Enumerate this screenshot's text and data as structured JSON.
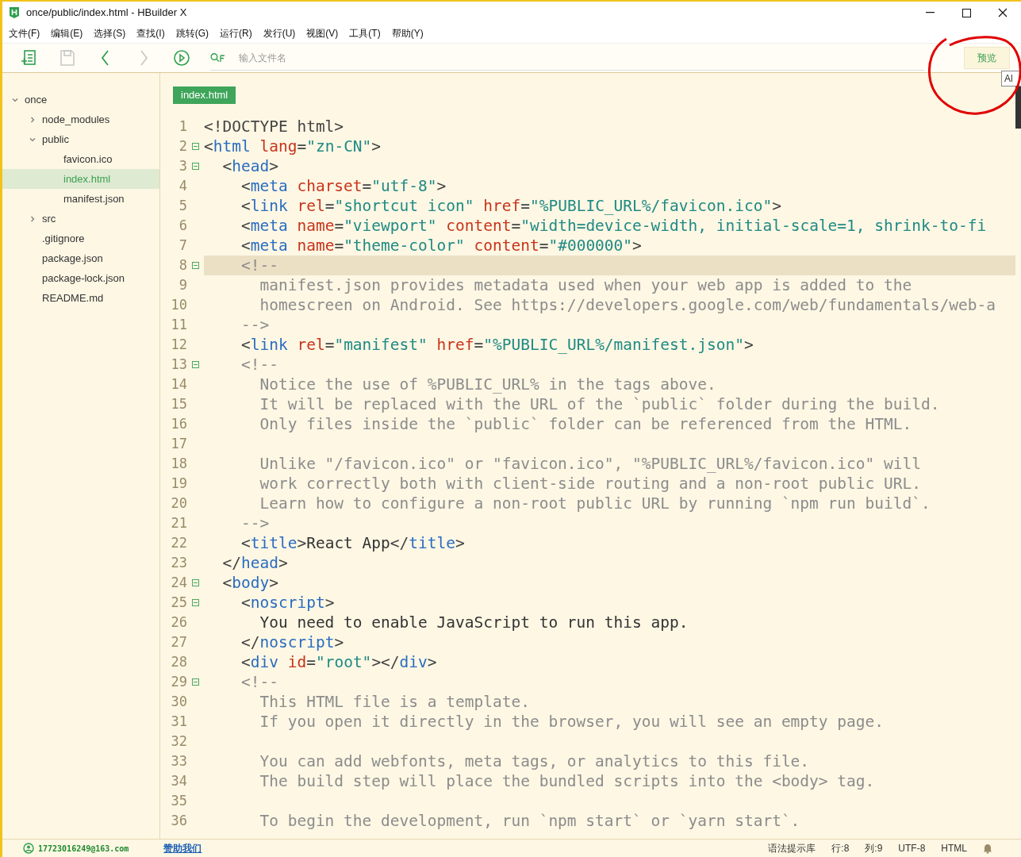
{
  "window": {
    "title": "once/public/index.html - HBuilder X"
  },
  "menu": [
    "文件(F)",
    "编辑(E)",
    "选择(S)",
    "查找(I)",
    "跳转(G)",
    "运行(R)",
    "发行(U)",
    "视图(V)",
    "工具(T)",
    "帮助(Y)"
  ],
  "toolbar": {
    "tools": [
      {
        "kind": "new",
        "disabled": false
      },
      {
        "kind": "save",
        "disabled": true
      },
      {
        "kind": "back",
        "disabled": false
      },
      {
        "kind": "forward",
        "disabled": true
      },
      {
        "kind": "run",
        "disabled": false
      }
    ],
    "search": {
      "placeholder": "输入文件名"
    },
    "preview_button": "预览",
    "tooltip": "Al"
  },
  "sidebar": {
    "items": [
      {
        "label": "once",
        "kind": "folder",
        "expanded": true,
        "selected": false,
        "children": [
          {
            "label": "node_modules",
            "kind": "folder",
            "expanded": false,
            "selected": false
          },
          {
            "label": "public",
            "kind": "folder",
            "expanded": true,
            "selected": false,
            "children": [
              {
                "label": "favicon.ico",
                "kind": "file",
                "selected": false
              },
              {
                "label": "index.html",
                "kind": "file",
                "selected": true
              },
              {
                "label": "manifest.json",
                "kind": "file",
                "selected": false
              }
            ]
          },
          {
            "label": "src",
            "kind": "folder",
            "expanded": false,
            "selected": false
          },
          {
            "label": ".gitignore",
            "kind": "file",
            "selected": false
          },
          {
            "label": "package.json",
            "kind": "file",
            "selected": false
          },
          {
            "label": "package-lock.json",
            "kind": "file",
            "selected": false
          },
          {
            "label": "README.md",
            "kind": "file",
            "selected": false
          }
        ]
      }
    ]
  },
  "tabs": [
    {
      "label": "index.html",
      "selected": true
    }
  ],
  "editor": {
    "lines": [
      {
        "number": "1",
        "foldable": false,
        "current": false,
        "tokens": [
          {
            "kind": "punct",
            "text": "<!DOCTYPE html>"
          }
        ]
      },
      {
        "number": "2",
        "foldable": true,
        "current": false,
        "tokens": [
          {
            "kind": "punct",
            "text": "<"
          },
          {
            "kind": "tag",
            "text": "html"
          },
          {
            "kind": "attr",
            "text": " lang"
          },
          {
            "kind": "punct",
            "text": "="
          },
          {
            "kind": "str",
            "text": "\"zn-CN\""
          },
          {
            "kind": "punct",
            "text": ">"
          }
        ]
      },
      {
        "number": "3",
        "foldable": true,
        "current": false,
        "tokens": [
          {
            "kind": "punct",
            "text": "  <"
          },
          {
            "kind": "tag",
            "text": "head"
          },
          {
            "kind": "punct",
            "text": ">"
          }
        ]
      },
      {
        "number": "4",
        "foldable": false,
        "current": false,
        "tokens": [
          {
            "kind": "punct",
            "text": "    <"
          },
          {
            "kind": "tag",
            "text": "meta"
          },
          {
            "kind": "attr",
            "text": " charset"
          },
          {
            "kind": "punct",
            "text": "="
          },
          {
            "kind": "str",
            "text": "\"utf-8\""
          },
          {
            "kind": "punct",
            "text": ">"
          }
        ]
      },
      {
        "number": "5",
        "foldable": false,
        "current": false,
        "tokens": [
          {
            "kind": "punct",
            "text": "    <"
          },
          {
            "kind": "tag",
            "text": "link"
          },
          {
            "kind": "attr",
            "text": " rel"
          },
          {
            "kind": "punct",
            "text": "="
          },
          {
            "kind": "str",
            "text": "\"shortcut icon\""
          },
          {
            "kind": "attr",
            "text": " href"
          },
          {
            "kind": "punct",
            "text": "="
          },
          {
            "kind": "str",
            "text": "\"%PUBLIC_URL%/favicon.ico\""
          },
          {
            "kind": "punct",
            "text": ">"
          }
        ]
      },
      {
        "number": "6",
        "foldable": false,
        "current": false,
        "tokens": [
          {
            "kind": "punct",
            "text": "    <"
          },
          {
            "kind": "tag",
            "text": "meta"
          },
          {
            "kind": "attr",
            "text": " name"
          },
          {
            "kind": "punct",
            "text": "="
          },
          {
            "kind": "str",
            "text": "\"viewport\""
          },
          {
            "kind": "attr",
            "text": " content"
          },
          {
            "kind": "punct",
            "text": "="
          },
          {
            "kind": "str",
            "text": "\"width=device-width, initial-scale=1, shrink-to-fi"
          }
        ]
      },
      {
        "number": "7",
        "foldable": false,
        "current": false,
        "tokens": [
          {
            "kind": "punct",
            "text": "    <"
          },
          {
            "kind": "tag",
            "text": "meta"
          },
          {
            "kind": "attr",
            "text": " name"
          },
          {
            "kind": "punct",
            "text": "="
          },
          {
            "kind": "str",
            "text": "\"theme-color\""
          },
          {
            "kind": "attr",
            "text": " content"
          },
          {
            "kind": "punct",
            "text": "="
          },
          {
            "kind": "str",
            "text": "\"#000000\""
          },
          {
            "kind": "punct",
            "text": ">"
          }
        ]
      },
      {
        "number": "8",
        "foldable": true,
        "current": true,
        "tokens": [
          {
            "kind": "comment",
            "text": "    <!--"
          }
        ]
      },
      {
        "number": "9",
        "foldable": false,
        "current": false,
        "tokens": [
          {
            "kind": "comment",
            "text": "      manifest.json provides metadata used when your web app is added to the"
          }
        ]
      },
      {
        "number": "10",
        "foldable": false,
        "current": false,
        "tokens": [
          {
            "kind": "comment",
            "text": "      homescreen on Android. See https://developers.google.com/web/fundamentals/web-a"
          }
        ]
      },
      {
        "number": "11",
        "foldable": false,
        "current": false,
        "tokens": [
          {
            "kind": "comment",
            "text": "    -->"
          }
        ]
      },
      {
        "number": "12",
        "foldable": false,
        "current": false,
        "tokens": [
          {
            "kind": "punct",
            "text": "    <"
          },
          {
            "kind": "tag",
            "text": "link"
          },
          {
            "kind": "attr",
            "text": " rel"
          },
          {
            "kind": "punct",
            "text": "="
          },
          {
            "kind": "str",
            "text": "\"manifest\""
          },
          {
            "kind": "attr",
            "text": " href"
          },
          {
            "kind": "punct",
            "text": "="
          },
          {
            "kind": "str",
            "text": "\"%PUBLIC_URL%/manifest.json\""
          },
          {
            "kind": "punct",
            "text": ">"
          }
        ]
      },
      {
        "number": "13",
        "foldable": true,
        "current": false,
        "tokens": [
          {
            "kind": "comment",
            "text": "    <!--"
          }
        ]
      },
      {
        "number": "14",
        "foldable": false,
        "current": false,
        "tokens": [
          {
            "kind": "comment",
            "text": "      Notice the use of %PUBLIC_URL% in the tags above."
          }
        ]
      },
      {
        "number": "15",
        "foldable": false,
        "current": false,
        "tokens": [
          {
            "kind": "comment",
            "text": "      It will be replaced with the URL of the `public` folder during the build."
          }
        ]
      },
      {
        "number": "16",
        "foldable": false,
        "current": false,
        "tokens": [
          {
            "kind": "comment",
            "text": "      Only files inside the `public` folder can be referenced from the HTML."
          }
        ]
      },
      {
        "number": "17",
        "foldable": false,
        "current": false
      },
      {
        "number": "18",
        "foldable": false,
        "current": false,
        "tokens": [
          {
            "kind": "comment",
            "text": "      Unlike \"/favicon.ico\" or \"favicon.ico\", \"%PUBLIC_URL%/favicon.ico\" will"
          }
        ]
      },
      {
        "number": "19",
        "foldable": false,
        "current": false,
        "tokens": [
          {
            "kind": "comment",
            "text": "      work correctly both with client-side routing and a non-root public URL."
          }
        ]
      },
      {
        "number": "20",
        "foldable": false,
        "current": false,
        "tokens": [
          {
            "kind": "comment",
            "text": "      Learn how to configure a non-root public URL by running `npm run build`."
          }
        ]
      },
      {
        "number": "21",
        "foldable": false,
        "current": false,
        "tokens": [
          {
            "kind": "comment",
            "text": "    -->"
          }
        ]
      },
      {
        "number": "22",
        "foldable": false,
        "current": false,
        "tokens": [
          {
            "kind": "punct",
            "text": "    <"
          },
          {
            "kind": "tag",
            "text": "title"
          },
          {
            "kind": "punct",
            "text": ">"
          },
          {
            "kind": "text",
            "text": "React App"
          },
          {
            "kind": "punct",
            "text": "</"
          },
          {
            "kind": "tag",
            "text": "title"
          },
          {
            "kind": "punct",
            "text": ">"
          }
        ]
      },
      {
        "number": "23",
        "foldable": false,
        "current": false,
        "tokens": [
          {
            "kind": "punct",
            "text": "  </"
          },
          {
            "kind": "tag",
            "text": "head"
          },
          {
            "kind": "punct",
            "text": ">"
          }
        ]
      },
      {
        "number": "24",
        "foldable": true,
        "current": false,
        "tokens": [
          {
            "kind": "punct",
            "text": "  <"
          },
          {
            "kind": "tag",
            "text": "body"
          },
          {
            "kind": "punct",
            "text": ">"
          }
        ]
      },
      {
        "number": "25",
        "foldable": true,
        "current": false,
        "tokens": [
          {
            "kind": "punct",
            "text": "    <"
          },
          {
            "kind": "tag",
            "text": "noscript"
          },
          {
            "kind": "punct",
            "text": ">"
          }
        ]
      },
      {
        "number": "26",
        "foldable": false,
        "current": false,
        "tokens": [
          {
            "kind": "text",
            "text": "      You need to enable JavaScript to run this app."
          }
        ]
      },
      {
        "number": "27",
        "foldable": false,
        "current": false,
        "tokens": [
          {
            "kind": "punct",
            "text": "    </"
          },
          {
            "kind": "tag",
            "text": "noscript"
          },
          {
            "kind": "punct",
            "text": ">"
          }
        ]
      },
      {
        "number": "28",
        "foldable": false,
        "current": false,
        "tokens": [
          {
            "kind": "punct",
            "text": "    <"
          },
          {
            "kind": "tag",
            "text": "div"
          },
          {
            "kind": "attr",
            "text": " id"
          },
          {
            "kind": "punct",
            "text": "="
          },
          {
            "kind": "str",
            "text": "\"root\""
          },
          {
            "kind": "punct",
            "text": "></"
          },
          {
            "kind": "tag",
            "text": "div"
          },
          {
            "kind": "punct",
            "text": ">"
          }
        ]
      },
      {
        "number": "29",
        "foldable": true,
        "current": false,
        "tokens": [
          {
            "kind": "comment",
            "text": "    <!--"
          }
        ]
      },
      {
        "number": "30",
        "foldable": false,
        "current": false,
        "tokens": [
          {
            "kind": "comment",
            "text": "      This HTML file is a template."
          }
        ]
      },
      {
        "number": "31",
        "foldable": false,
        "current": false,
        "tokens": [
          {
            "kind": "comment",
            "text": "      If you open it directly in the browser, you will see an empty page."
          }
        ]
      },
      {
        "number": "32",
        "foldable": false,
        "current": false
      },
      {
        "number": "33",
        "foldable": false,
        "current": false,
        "tokens": [
          {
            "kind": "comment",
            "text": "      You can add webfonts, meta tags, or analytics to this file."
          }
        ]
      },
      {
        "number": "34",
        "foldable": false,
        "current": false,
        "tokens": [
          {
            "kind": "comment",
            "text": "      The build step will place the bundled scripts into the <body> tag."
          }
        ]
      },
      {
        "number": "35",
        "foldable": false,
        "current": false
      },
      {
        "number": "36",
        "foldable": false,
        "current": false,
        "tokens": [
          {
            "kind": "comment",
            "text": "      To begin the development, run `npm start` or `yarn start`."
          }
        ]
      }
    ]
  },
  "status_bar": {
    "account": "17723016249@163.com",
    "sponsor_link": "赞助我们",
    "items": [
      "语法提示库",
      "行:8",
      "列:9",
      "UTF-8",
      "HTML"
    ]
  }
}
